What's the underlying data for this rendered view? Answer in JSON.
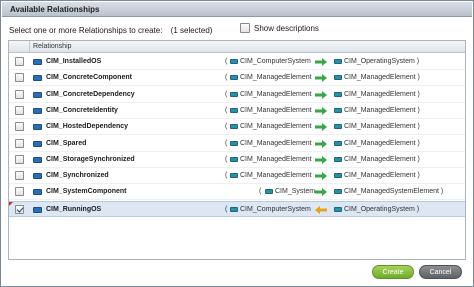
{
  "dialog": {
    "title": "Available Relationships",
    "instruction": "Select one or more Relationships to create:",
    "selected_count": "(1 selected)",
    "show_descriptions_label": "Show descriptions",
    "show_descriptions_checked": false
  },
  "grid": {
    "column_header": "Relationship",
    "rows": [
      {
        "name": "CIM_InstalledOS",
        "source": "CIM_ComputerSystem",
        "target": "CIM_OperatingSystem",
        "checked": false,
        "direction": "right"
      },
      {
        "name": "CIM_ConcreteComponent",
        "source": "CIM_ManagedElement",
        "target": "CIM_ManagedElement",
        "checked": false,
        "direction": "right"
      },
      {
        "name": "CIM_ConcreteDependency",
        "source": "CIM_ManagedElement",
        "target": "CIM_ManagedElement",
        "checked": false,
        "direction": "right"
      },
      {
        "name": "CIM_ConcreteIdentity",
        "source": "CIM_ManagedElement",
        "target": "CIM_ManagedElement",
        "checked": false,
        "direction": "right"
      },
      {
        "name": "CIM_HostedDependency",
        "source": "CIM_ManagedElement",
        "target": "CIM_ManagedElement",
        "checked": false,
        "direction": "right"
      },
      {
        "name": "CIM_Spared",
        "source": "CIM_ManagedElement",
        "target": "CIM_ManagedElement",
        "checked": false,
        "direction": "right"
      },
      {
        "name": "CIM_StorageSynchronized",
        "source": "CIM_ManagedElement",
        "target": "CIM_ManagedElement",
        "checked": false,
        "direction": "right"
      },
      {
        "name": "CIM_Synchronized",
        "source": "CIM_ManagedElement",
        "target": "CIM_ManagedElement",
        "checked": false,
        "direction": "right"
      },
      {
        "name": "CIM_SystemComponent",
        "source": "CIM_System",
        "target": "CIM_ManagedSystemElement",
        "checked": false,
        "direction": "right"
      },
      {
        "name": "CIM_RunningOS",
        "source": "CIM_ComputerSystem",
        "target": "CIM_OperatingSystem",
        "checked": true,
        "direction": "left"
      }
    ]
  },
  "buttons": {
    "create": "Create",
    "cancel": "Cancel"
  },
  "colors": {
    "arrow_right": "#3aa64a",
    "arrow_left": "#e8a21a",
    "selected_row": "#dde6f3",
    "create_button": "#7fbb35",
    "cancel_button": "#6b6f74"
  }
}
